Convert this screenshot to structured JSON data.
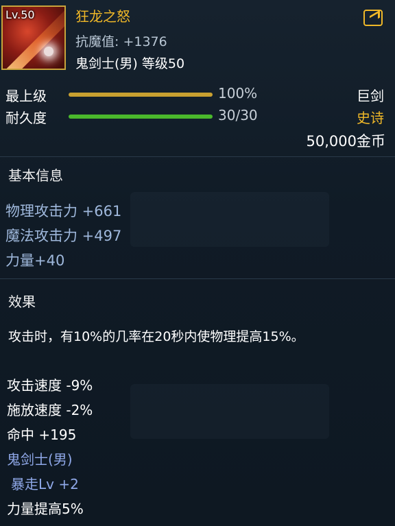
{
  "item": {
    "level_badge": "Lv.50",
    "name": "狂龙之怒",
    "resist_label": "抗魔值: +1376",
    "class_level": "鬼剑士(男) 等级50",
    "share_icon": "share-arrow-icon",
    "weapon_icon": "great-sword-icon"
  },
  "bars": [
    {
      "label": "最上级",
      "value": "100%",
      "fill": 1.0,
      "color": "#c8a030",
      "right": "巨剑",
      "right_color": "#ffffff"
    },
    {
      "label": "耐久度",
      "value": "30/30",
      "fill": 1.0,
      "color": "#4ab82c",
      "right": "史诗",
      "right_color": "#f0b828"
    }
  ],
  "price": "50,000金币",
  "basic": {
    "title": "基本信息",
    "stats": [
      "物理攻击力 +661",
      "魔法攻击力 +497",
      "力量+40"
    ]
  },
  "effect": {
    "title": "效果",
    "description": "攻击时，有10%的几率在20秒内使物理提高15%。",
    "lines": [
      {
        "text": "攻击速度 -9%",
        "style": "white"
      },
      {
        "text": "施放速度 -2%",
        "style": "white"
      },
      {
        "text": "命中 +195",
        "style": "white"
      },
      {
        "text": "鬼剑士(男)",
        "style": "blue"
      },
      {
        "text": "暴走Lv +2",
        "style": "blue"
      },
      {
        "text": "力量提高5%",
        "style": "white"
      }
    ]
  },
  "colors": {
    "gold": "#f0b828",
    "epic": "#f0b828",
    "class_blue": "#8fa8e8",
    "background": "#111c27"
  }
}
